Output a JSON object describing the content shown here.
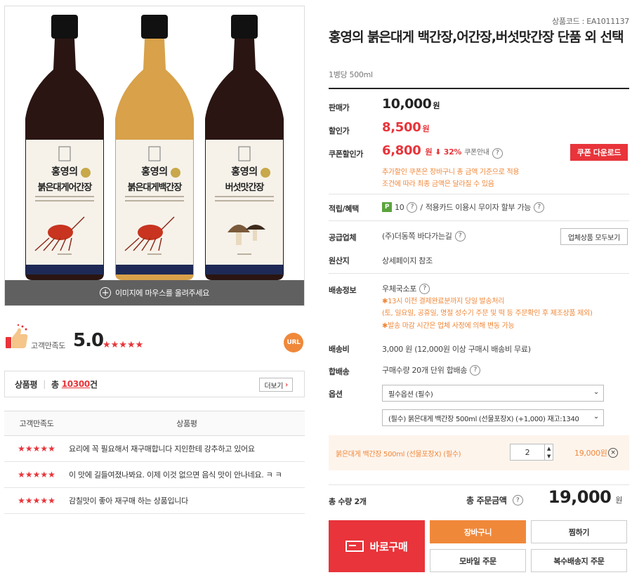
{
  "gallery": {
    "hover_hint": "이미지에 마우스를 올려주세요",
    "bottles": [
      {
        "brand": "홍영의",
        "name": "붉은대게어간장",
        "liquid": "#2a1512",
        "badge": "#c8a84a",
        "illustration": "crab"
      },
      {
        "brand": "홍영의",
        "name": "붉은대게백간장",
        "liquid": "#d8a14a",
        "badge": "#c8a84a",
        "illustration": "crab"
      },
      {
        "brand": "홍영의",
        "name": "버섯맛간장",
        "liquid": "#2a1512",
        "badge": "#c8a84a",
        "illustration": "mushroom"
      }
    ]
  },
  "satisfaction": {
    "label": "고객만족도",
    "score": "5.0",
    "stars": "★★★★★",
    "url_badge": "URL"
  },
  "review_summary": {
    "label": "상품평",
    "sep": "|",
    "total_prefix": "총",
    "count": "10300",
    "unit": "건",
    "more": "더보기"
  },
  "review_table": {
    "headers": [
      "고객만족도",
      "상품평"
    ],
    "rows": [
      {
        "stars": "★★★★★",
        "text": "요리에 꼭 필요해서 재구매합니다 지인한테 강추하고 있어요"
      },
      {
        "stars": "★★★★★",
        "text": "이 맛에 길들여졌나봐요. 이제 이것 없으면 음식 맛이 안나네요. ㅋ ㅋ"
      },
      {
        "stars": "★★★★★",
        "text": "감칠맛이 좋아 재구매 하는 상품입니다"
      }
    ]
  },
  "product": {
    "code": "상품코드 : EA1011137",
    "title": "홍영의 붉은대게 백간장,어간장,버섯맛간장 단품 외 선택",
    "subtitle": "1병당 500ml"
  },
  "prices": {
    "sale_label": "판매가",
    "sale_value": "10,000",
    "discount_label": "할인가",
    "discount_value": "8,500",
    "coupon_label": "쿠폰할인가",
    "coupon_value": "6,800",
    "coupon_pct": "⬇ 32%",
    "coupon_guide": "쿠폰안내",
    "coupon_button": "쿠폰 다운로드",
    "won": "원",
    "notice1": "추가할인 쿠폰은 장바구니 총 금액 기준으로 적용",
    "notice2": "조건에 따라 최종 금액은 달라질 수 있음"
  },
  "details": {
    "points_label": "적립/혜택",
    "points_badge": "P",
    "points_value": "10",
    "points_sep": "/",
    "points_note": "적용카드 이용시 무이자 할부 가능",
    "supplier_label": "공급업체",
    "supplier_value": "(주)더동쪽 바다가는길",
    "supplier_button": "업체상품 모두보기",
    "origin_label": "원산지",
    "origin_value": "상세페이지 참조",
    "shipping_label": "배송정보",
    "shipping_value": "우체국소포",
    "shipping_note1": "✱13시 이전 결제완료분까지 당일 발송처리",
    "shipping_note2": "(토, 일요일, 공휴일, 명절 성수기 주문 및 떡 등 주문확인 후 제조상품 제외)",
    "shipping_note3": "✱발송 마감 시간은 업체 사정에 의해 변동 가능",
    "fee_label": "배송비",
    "fee_value": "3,000 원 (12,000원 이상 구매시 배송비 무료)",
    "bundle_label": "합배송",
    "bundle_value": "구매수량 20개 단위 합배송",
    "option_label": "옵션",
    "option_select1": "필수옵션 (필수)",
    "option_select2": "(필수) 붉은대게 백간장 500ml (선물포장X) (+1,000) 재고:1340"
  },
  "selected_option": {
    "name": "붉은대게 백간장 500ml (선물포장X) (필수)",
    "quantity": "2",
    "price": "19,000원",
    "remove": "×"
  },
  "totals": {
    "qty_label": "총 수량 2개",
    "amount_label": "총 주문금액",
    "amount_value": "19,000",
    "won": "원"
  },
  "actions": {
    "buy": "바로구매",
    "cart": "장바구니",
    "wish": "찜하기",
    "mobile": "모바일 주문",
    "multi": "복수배송지 주문"
  },
  "colors": {
    "accent_red": "#e8343a",
    "accent_orange": "#f0883a",
    "hover_bar": "#606060"
  }
}
